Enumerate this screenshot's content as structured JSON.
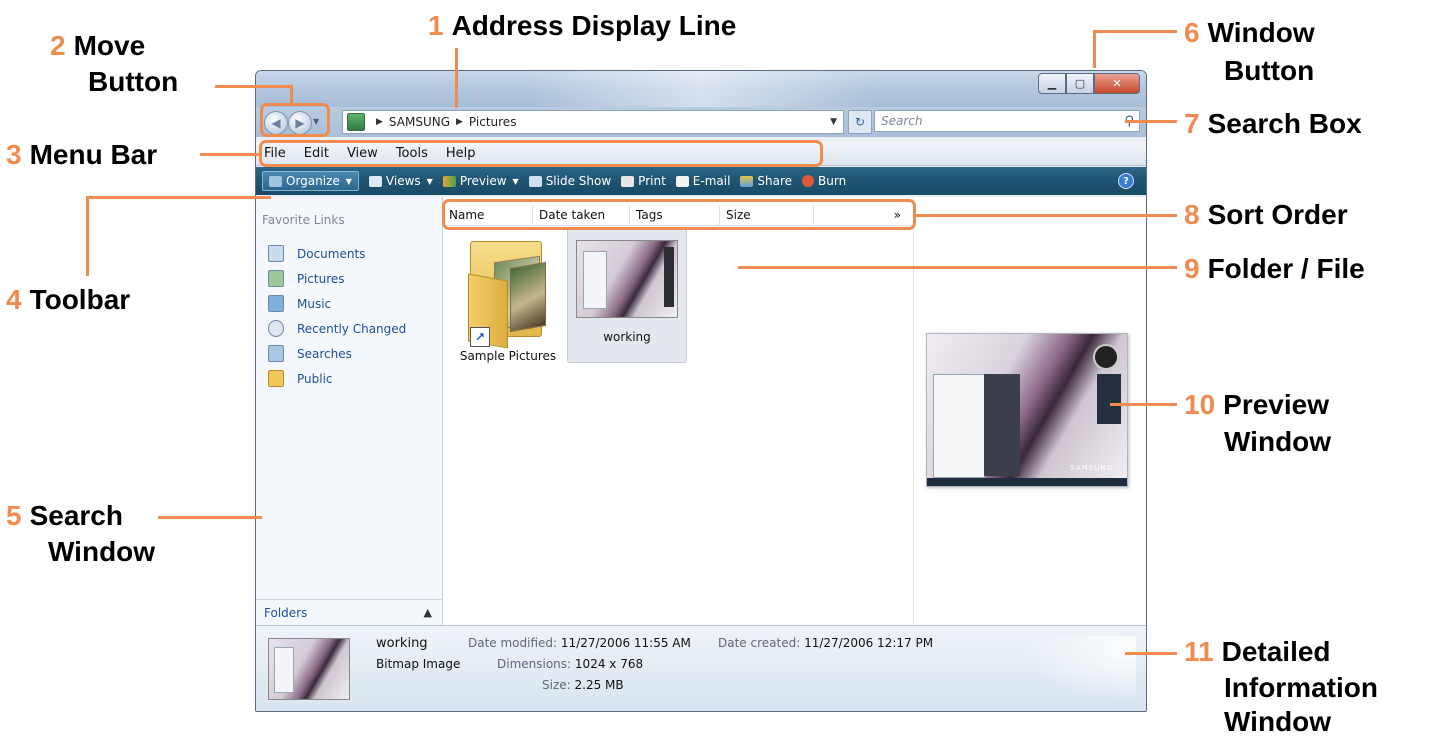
{
  "window": {
    "title_buttons": {
      "minimize_icon": "minimize-icon",
      "maximize_icon": "maximize-icon",
      "close_icon": "close-icon"
    },
    "address": {
      "root": "SAMSUNG",
      "folder": "Pictures"
    },
    "search": {
      "placeholder": "Search"
    },
    "menu": [
      "File",
      "Edit",
      "View",
      "Tools",
      "Help"
    ],
    "toolbar": [
      {
        "label": "Organize",
        "icon": "organize-icon",
        "dropdown": true
      },
      {
        "label": "Views",
        "icon": "views-icon",
        "dropdown": true
      },
      {
        "label": "Preview",
        "icon": "preview-icon",
        "dropdown": true
      },
      {
        "label": "Slide Show",
        "icon": "slideshow-icon"
      },
      {
        "label": "Print",
        "icon": "print-icon"
      },
      {
        "label": "E-mail",
        "icon": "email-icon"
      },
      {
        "label": "Share",
        "icon": "share-icon"
      },
      {
        "label": "Burn",
        "icon": "burn-icon"
      }
    ],
    "sidebar": {
      "title": "Favorite Links",
      "items": [
        "Documents",
        "Pictures",
        "Music",
        "Recently Changed",
        "Searches",
        "Public"
      ],
      "folders_label": "Folders"
    },
    "columns": [
      "Name",
      "Date taken",
      "Tags",
      "Size"
    ],
    "files": [
      {
        "name": "Sample Pictures",
        "type": "folder-shortcut"
      },
      {
        "name": "working",
        "type": "image"
      }
    ],
    "details": {
      "name": "working",
      "type": "Bitmap Image",
      "date_modified_label": "Date modified:",
      "date_modified": "11/27/2006 11:55 AM",
      "dimensions_label": "Dimensions:",
      "dimensions": "1024 x 768",
      "size_label": "Size:",
      "size": "2.25 MB",
      "date_created_label": "Date created:",
      "date_created": "11/27/2006 12:17 PM"
    },
    "preview_brand": "SAMSUNG"
  },
  "callouts": {
    "c1": {
      "num": "1",
      "text": "Address Display Line"
    },
    "c2": {
      "num": "2",
      "line1": "Move",
      "line2": "Button"
    },
    "c3": {
      "num": "3",
      "text": "Menu Bar"
    },
    "c4": {
      "num": "4",
      "text": "Toolbar"
    },
    "c5": {
      "num": "5",
      "line1": "Search",
      "line2": "Window"
    },
    "c6": {
      "num": "6",
      "line1": "Window",
      "line2": "Button"
    },
    "c7": {
      "num": "7",
      "text": "Search Box"
    },
    "c8": {
      "num": "8",
      "text": "Sort Order"
    },
    "c9": {
      "num": "9",
      "text": "Folder / File"
    },
    "c10": {
      "num": "10",
      "line1": "Preview",
      "line2": "Window"
    },
    "c11": {
      "num": "11",
      "line1": "Detailed",
      "line2": "Information",
      "line3": "Window"
    }
  },
  "colors": {
    "accent": "#f08c50",
    "toolbar": "#1f5472",
    "link": "#1f4f99"
  }
}
